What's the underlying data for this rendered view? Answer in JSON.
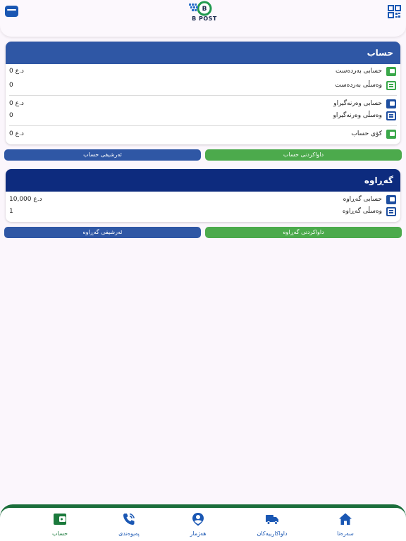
{
  "header": {
    "logo_text": "B POST",
    "logo_badge": "B"
  },
  "account_card": {
    "title": "حساب",
    "rows": [
      {
        "label": "حسابی بەردەست",
        "value": "0 د.ع",
        "icon": "wallet-icon"
      },
      {
        "label": "وەسڵی بەردەست",
        "value": "0",
        "icon": "receipt-icon"
      },
      {
        "label": "حسابی وەرنەگیراو",
        "value": "0 د.ع",
        "icon": "wallet-icon"
      },
      {
        "label": "وەسڵی وەرنەگیراو",
        "value": "0",
        "icon": "receipt-icon"
      },
      {
        "label": "کۆی حساب",
        "value": "0 د.ع",
        "icon": "wallet-icon"
      }
    ],
    "archive_button": "ئەرشیفی حساب",
    "request_button": "داواکردنی حساب"
  },
  "returns_card": {
    "title": "گەڕاوە",
    "rows": [
      {
        "label": "حسابی گەڕاوە",
        "value": "10,000 د.ع",
        "icon": "wallet-icon"
      },
      {
        "label": "وەسڵی گەڕاوە",
        "value": "1",
        "icon": "receipt-icon"
      }
    ],
    "archive_button": "ئەرشیفی گەڕاوە",
    "request_button": "داواکردنی گەڕاوە"
  },
  "bottom_nav": {
    "items": [
      {
        "label": "حساب",
        "icon": "wallet-icon",
        "active": true
      },
      {
        "label": "پەیوەندی",
        "icon": "phone-icon",
        "active": false
      },
      {
        "label": "هەژمار",
        "icon": "profile-icon",
        "active": false
      },
      {
        "label": "داواکارییەکان",
        "icon": "truck-icon",
        "active": false
      },
      {
        "label": "سەرەتا",
        "icon": "home-icon",
        "active": false
      }
    ]
  },
  "colors": {
    "account_header": "#2f57a5",
    "returns_header": "#0d2b7e",
    "green": "#4caa4c",
    "blue_button": "#2f57a5",
    "nav_accent": "#1b6e3b"
  }
}
